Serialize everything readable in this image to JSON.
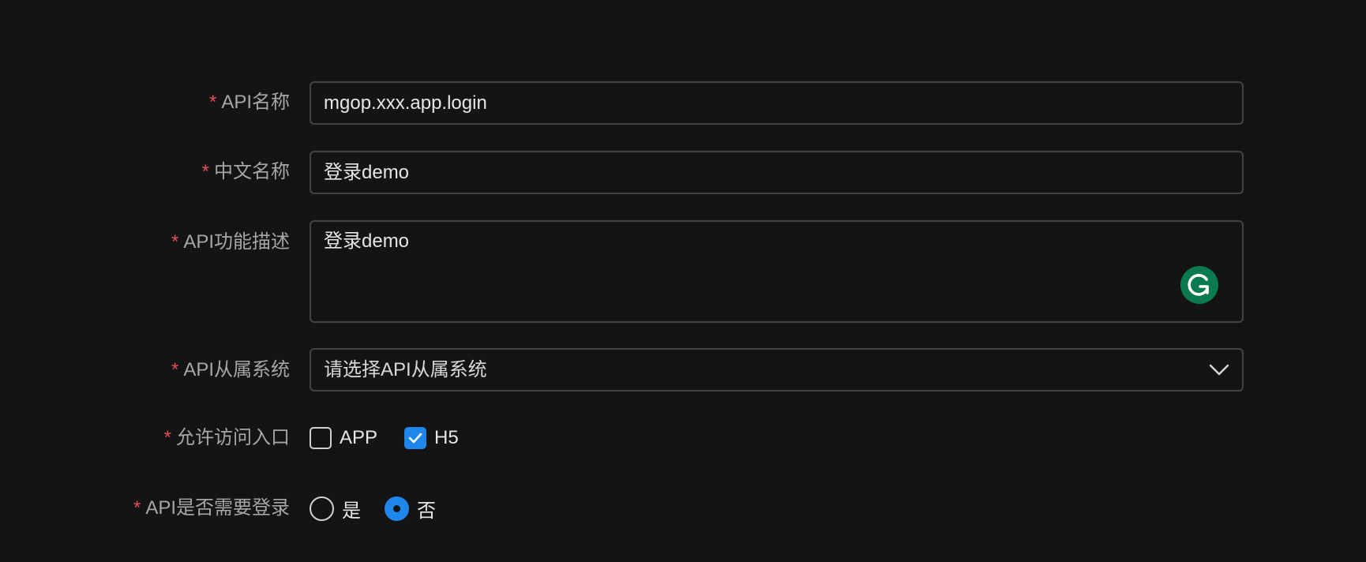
{
  "form": {
    "required_mark": "*",
    "api_name": {
      "label": "API名称",
      "value": "mgop.xxx.app.login"
    },
    "cn_name": {
      "label": "中文名称",
      "value": "登录demo"
    },
    "description": {
      "label": "API功能描述",
      "value": "登录demo",
      "assistant_icon": "grammarly-icon"
    },
    "system": {
      "label": "API从属系统",
      "placeholder": "请选择API从属系统",
      "icon": "chevron-down-icon"
    },
    "entry": {
      "label": "允许访问入口",
      "options": [
        {
          "label": "APP",
          "checked": false
        },
        {
          "label": "H5",
          "checked": true
        }
      ]
    },
    "login_required": {
      "label": "API是否需要登录",
      "options": [
        {
          "label": "是",
          "selected": false
        },
        {
          "label": "否",
          "selected": true
        }
      ]
    }
  },
  "colors": {
    "background": "#141414",
    "border": "#434343",
    "label": "#a6a6a6",
    "required": "#e34d59",
    "accent": "#1f87ea",
    "grammarly": "#0b7a4e"
  }
}
